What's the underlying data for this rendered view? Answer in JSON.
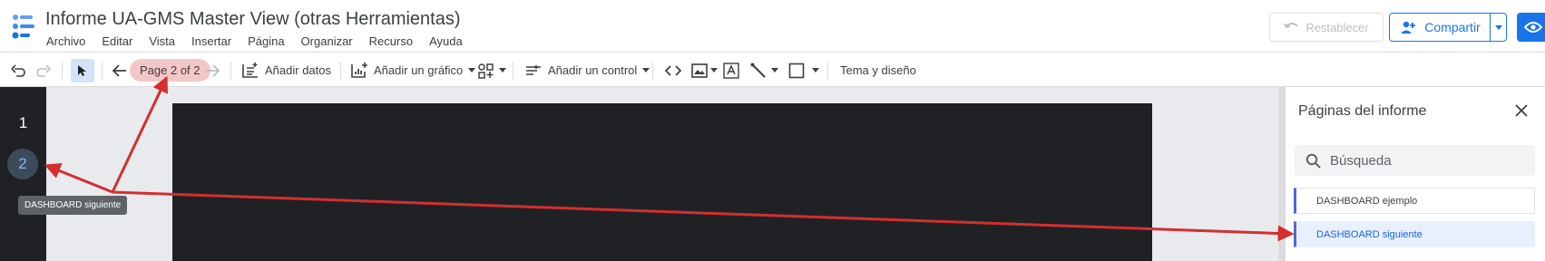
{
  "header": {
    "title": "Informe UA-GMS Master View (otras Herramientas)",
    "menu": [
      "Archivo",
      "Editar",
      "Vista",
      "Insertar",
      "Página",
      "Organizar",
      "Recurso",
      "Ayuda"
    ],
    "reset_label": "Restablecer",
    "share_label": "Compartir"
  },
  "toolbar": {
    "page_indicator": "Page 2 of 2",
    "add_data_label": "Añadir datos",
    "add_chart_label": "Añadir un gráfico",
    "add_control_label": "Añadir un control",
    "theme_label": "Tema y diseño"
  },
  "rail": {
    "pages": [
      "1",
      "2"
    ],
    "tooltip": "DASHBOARD siguiente"
  },
  "panel": {
    "title": "Páginas del informe",
    "search_placeholder": "Búsqueda",
    "pages": [
      {
        "label": "DASHBOARD ejemplo",
        "selected": false
      },
      {
        "label": "DASHBOARD siguiente",
        "selected": true
      }
    ]
  },
  "colors": {
    "accent": "#1a73e8",
    "annotation_arrow": "#d32f2f",
    "page_pill": "#f4c7c7",
    "canvas_dark": "#202124"
  }
}
